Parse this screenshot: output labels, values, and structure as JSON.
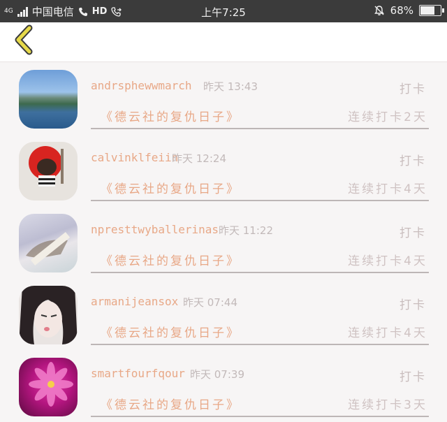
{
  "status_bar": {
    "network": "4G",
    "carrier": "中国电信",
    "hd": "HD",
    "time": "上午7:25",
    "battery": "68%"
  },
  "nav": {
    "back_icon": "chevron-left-icon",
    "accent": "#e6d94a"
  },
  "entries": [
    {
      "user": "andrsphewwmarch",
      "time": "昨天 13:43",
      "action": "打卡",
      "book": "《德云社的复仇日子》",
      "streak": "连续打卡2天"
    },
    {
      "user": "calvinklfeiin",
      "time": "昨天 12:24",
      "action": "打卡",
      "book": "《德云社的复仇日子》",
      "streak": "连续打卡4天"
    },
    {
      "user": "npresttwyballerinas",
      "time": "昨天 11:22",
      "action": "打卡",
      "book": "《德云社的复仇日子》",
      "streak": "连续打卡4天"
    },
    {
      "user": "armanijeansox",
      "time": "昨天 07:44",
      "action": "打卡",
      "book": "《德云社的复仇日子》",
      "streak": "连续打卡4天"
    },
    {
      "user": "smartfourfqour",
      "time": "昨天 07:39",
      "action": "打卡",
      "book": "《德云社的复仇日子》",
      "streak": "连续打卡3天"
    }
  ],
  "colors": {
    "name": "#e8a887",
    "muted": "#c2b9b9",
    "background": "#f7f5f5"
  }
}
